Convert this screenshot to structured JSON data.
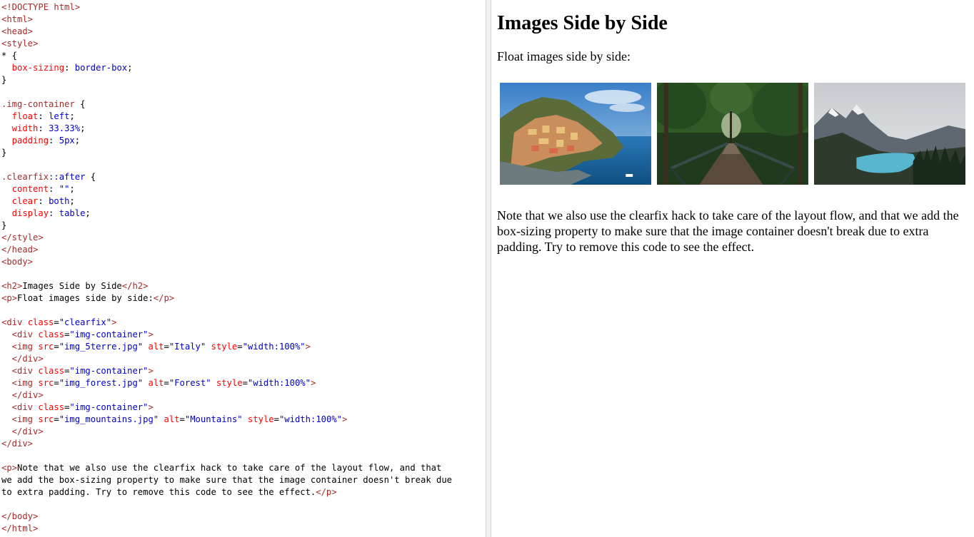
{
  "code_lines": [
    [
      {
        "t": "<!DOCTYPE html>",
        "c": "tag"
      }
    ],
    [
      {
        "t": "<html>",
        "c": "tag"
      }
    ],
    [
      {
        "t": "<head>",
        "c": "tag"
      }
    ],
    [
      {
        "t": "<style>",
        "c": "tag"
      }
    ],
    [
      {
        "t": "* {",
        "c": "plain"
      }
    ],
    [
      {
        "t": "  box-sizing",
        "c": "prop"
      },
      {
        "t": ": ",
        "c": "plain"
      },
      {
        "t": "border-box",
        "c": "pval"
      },
      {
        "t": ";",
        "c": "plain"
      }
    ],
    [
      {
        "t": "}",
        "c": "plain"
      }
    ],
    [
      {
        "t": "",
        "c": "plain"
      }
    ],
    [
      {
        "t": ".img-container",
        "c": "sel"
      },
      {
        "t": " {",
        "c": "plain"
      }
    ],
    [
      {
        "t": "  float",
        "c": "prop"
      },
      {
        "t": ": ",
        "c": "plain"
      },
      {
        "t": "left",
        "c": "pval"
      },
      {
        "t": ";",
        "c": "plain"
      }
    ],
    [
      {
        "t": "  width",
        "c": "prop"
      },
      {
        "t": ": ",
        "c": "plain"
      },
      {
        "t": "33.33%",
        "c": "pval"
      },
      {
        "t": ";",
        "c": "plain"
      }
    ],
    [
      {
        "t": "  padding",
        "c": "prop"
      },
      {
        "t": ": ",
        "c": "plain"
      },
      {
        "t": "5px",
        "c": "pval"
      },
      {
        "t": ";",
        "c": "plain"
      }
    ],
    [
      {
        "t": "}",
        "c": "plain"
      }
    ],
    [
      {
        "t": "",
        "c": "plain"
      }
    ],
    [
      {
        "t": ".clearfix",
        "c": "sel"
      },
      {
        "t": "::after",
        "c": "pseudo"
      },
      {
        "t": " {",
        "c": "plain"
      }
    ],
    [
      {
        "t": "  content",
        "c": "prop"
      },
      {
        "t": ": ",
        "c": "plain"
      },
      {
        "t": "\"\"",
        "c": "pval"
      },
      {
        "t": ";",
        "c": "plain"
      }
    ],
    [
      {
        "t": "  clear",
        "c": "prop"
      },
      {
        "t": ": ",
        "c": "plain"
      },
      {
        "t": "both",
        "c": "pval"
      },
      {
        "t": ";",
        "c": "plain"
      }
    ],
    [
      {
        "t": "  display",
        "c": "prop"
      },
      {
        "t": ": ",
        "c": "plain"
      },
      {
        "t": "table",
        "c": "pval"
      },
      {
        "t": ";",
        "c": "plain"
      }
    ],
    [
      {
        "t": "}",
        "c": "plain"
      }
    ],
    [
      {
        "t": "</style>",
        "c": "tag"
      }
    ],
    [
      {
        "t": "</head>",
        "c": "tag"
      }
    ],
    [
      {
        "t": "<body>",
        "c": "tag"
      }
    ],
    [
      {
        "t": "",
        "c": "plain"
      }
    ],
    [
      {
        "t": "<h2>",
        "c": "tag"
      },
      {
        "t": "Images Side by Side",
        "c": "plain"
      },
      {
        "t": "</h2>",
        "c": "tag"
      }
    ],
    [
      {
        "t": "<p>",
        "c": "tag"
      },
      {
        "t": "Float images side by side:",
        "c": "plain"
      },
      {
        "t": "</p>",
        "c": "tag"
      }
    ],
    [
      {
        "t": "",
        "c": "plain"
      }
    ],
    [
      {
        "t": "<div ",
        "c": "tag"
      },
      {
        "t": "class",
        "c": "attr"
      },
      {
        "t": "=",
        "c": "plain"
      },
      {
        "t": "\"clearfix\"",
        "c": "val"
      },
      {
        "t": ">",
        "c": "tag"
      }
    ],
    [
      {
        "t": "  <div ",
        "c": "tag"
      },
      {
        "t": "class",
        "c": "attr"
      },
      {
        "t": "=",
        "c": "plain"
      },
      {
        "t": "\"img-container\"",
        "c": "val"
      },
      {
        "t": ">",
        "c": "tag"
      }
    ],
    [
      {
        "t": "  <img ",
        "c": "tag"
      },
      {
        "t": "src",
        "c": "attr"
      },
      {
        "t": "=",
        "c": "plain"
      },
      {
        "t": "\"img_5terre.jpg\"",
        "c": "val"
      },
      {
        "t": " alt",
        "c": "attr"
      },
      {
        "t": "=",
        "c": "plain"
      },
      {
        "t": "\"Italy\"",
        "c": "val"
      },
      {
        "t": " style",
        "c": "attr"
      },
      {
        "t": "=",
        "c": "plain"
      },
      {
        "t": "\"width:100%\"",
        "c": "val"
      },
      {
        "t": ">",
        "c": "tag"
      }
    ],
    [
      {
        "t": "  </div>",
        "c": "tag"
      }
    ],
    [
      {
        "t": "  <div ",
        "c": "tag"
      },
      {
        "t": "class",
        "c": "attr"
      },
      {
        "t": "=",
        "c": "plain"
      },
      {
        "t": "\"img-container\"",
        "c": "val"
      },
      {
        "t": ">",
        "c": "tag"
      }
    ],
    [
      {
        "t": "  <img ",
        "c": "tag"
      },
      {
        "t": "src",
        "c": "attr"
      },
      {
        "t": "=",
        "c": "plain"
      },
      {
        "t": "\"img_forest.jpg\"",
        "c": "val"
      },
      {
        "t": " alt",
        "c": "attr"
      },
      {
        "t": "=",
        "c": "plain"
      },
      {
        "t": "\"Forest\"",
        "c": "val"
      },
      {
        "t": " style",
        "c": "attr"
      },
      {
        "t": "=",
        "c": "plain"
      },
      {
        "t": "\"width:100%\"",
        "c": "val"
      },
      {
        "t": ">",
        "c": "tag"
      }
    ],
    [
      {
        "t": "  </div>",
        "c": "tag"
      }
    ],
    [
      {
        "t": "  <div ",
        "c": "tag"
      },
      {
        "t": "class",
        "c": "attr"
      },
      {
        "t": "=",
        "c": "plain"
      },
      {
        "t": "\"img-container\"",
        "c": "val"
      },
      {
        "t": ">",
        "c": "tag"
      }
    ],
    [
      {
        "t": "  <img ",
        "c": "tag"
      },
      {
        "t": "src",
        "c": "attr"
      },
      {
        "t": "=",
        "c": "plain"
      },
      {
        "t": "\"img_mountains.jpg\"",
        "c": "val"
      },
      {
        "t": " alt",
        "c": "attr"
      },
      {
        "t": "=",
        "c": "plain"
      },
      {
        "t": "\"Mountains\"",
        "c": "val"
      },
      {
        "t": " style",
        "c": "attr"
      },
      {
        "t": "=",
        "c": "plain"
      },
      {
        "t": "\"width:100%\"",
        "c": "val"
      },
      {
        "t": ">",
        "c": "tag"
      }
    ],
    [
      {
        "t": "  </div>",
        "c": "tag"
      }
    ],
    [
      {
        "t": "</div>",
        "c": "tag"
      }
    ],
    [
      {
        "t": "",
        "c": "plain"
      }
    ],
    [
      {
        "t": "<p>",
        "c": "tag"
      },
      {
        "t": "Note that we also use the clearfix hack to take care of the layout flow, and that",
        "c": "plain"
      }
    ],
    [
      {
        "t": "we add the box-sizing property to make sure that the image container doesn't break due",
        "c": "plain"
      }
    ],
    [
      {
        "t": "to extra padding. Try to remove this code to see the effect.",
        "c": "plain"
      },
      {
        "t": "</p>",
        "c": "tag"
      }
    ],
    [
      {
        "t": "",
        "c": "plain"
      }
    ],
    [
      {
        "t": "</body>",
        "c": "tag"
      }
    ],
    [
      {
        "t": "</html>",
        "c": "tag"
      }
    ]
  ],
  "result": {
    "heading": "Images Side by Side",
    "intro": "Float images side by side:",
    "images": [
      {
        "alt": "Italy",
        "icon": "coastal-village-image"
      },
      {
        "alt": "Forest",
        "icon": "forest-bridge-image"
      },
      {
        "alt": "Mountains",
        "icon": "mountain-lake-image"
      }
    ],
    "note": "Note that we also use the clearfix hack to take care of the layout flow, and that we add the box-sizing property to make sure that the image container doesn't break due to extra padding. Try to remove this code to see the effect."
  },
  "colors": {
    "tag": "#a52a2a",
    "attr": "#ff0000",
    "value": "#0000cd"
  }
}
